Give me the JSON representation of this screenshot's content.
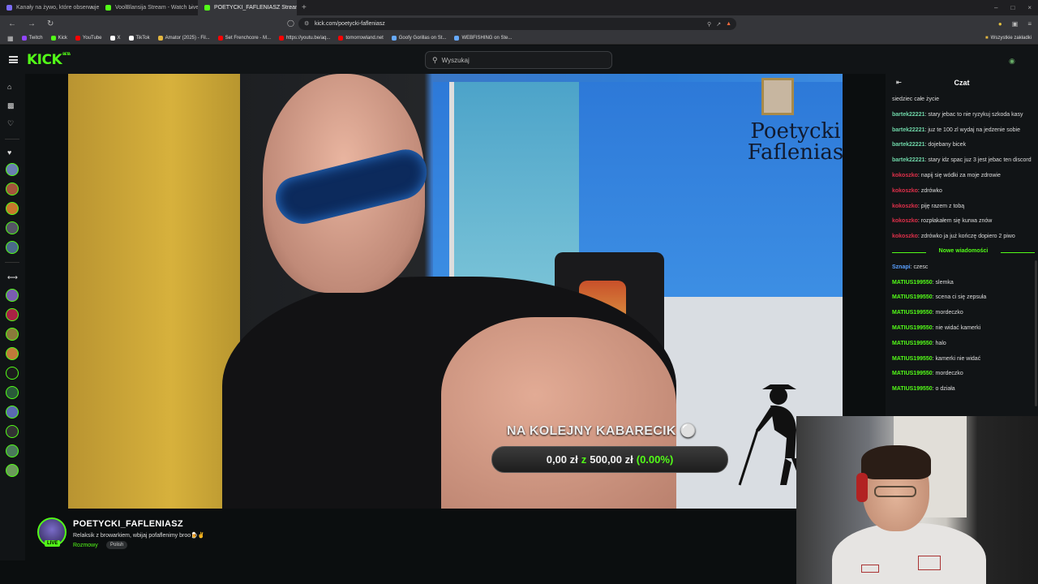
{
  "browser": {
    "tabs": [
      {
        "label": "Kanały na żywo, które obserwujesz",
        "color": "#7b6cf6",
        "active": false
      },
      {
        "label": "VoolBlansija Stream - Watch Live",
        "color": "#53fc18",
        "active": false
      },
      {
        "label": "POETYCKI_FAFLENIASZ Stream",
        "color": "#53fc18",
        "active": true
      }
    ],
    "url": "kick.com/poetycki-fafleniasz",
    "bookmarks": [
      {
        "label": "Twitch",
        "color": "#9146ff"
      },
      {
        "label": "Kick",
        "color": "#53fc18"
      },
      {
        "label": "YouTube",
        "color": "#ff0000"
      },
      {
        "label": "X",
        "color": "#ffffff"
      },
      {
        "label": "TikTok",
        "color": "#ffffff"
      },
      {
        "label": "Amator (2025) - Fil...",
        "color": "#e2b640"
      },
      {
        "label": "Set Frenchcore - M...",
        "color": "#ff0000"
      },
      {
        "label": "https://youtu.be/aq...",
        "color": "#ff0000"
      },
      {
        "label": "tomorrowland.net",
        "color": "#ff0000"
      },
      {
        "label": "Goofy Gorillas on St...",
        "color": "#66aaff"
      },
      {
        "label": "WEBFISHING on Ste...",
        "color": "#66aaff"
      }
    ],
    "bookmarks_all": "Wszystkie zakładki"
  },
  "kick": {
    "logo": "KICK",
    "logo_beta": "BETA",
    "search_placeholder": "Wyszukaj",
    "accent": "#53fc18"
  },
  "stream": {
    "overlay_title": "Poetycki Faflenias",
    "goal_title": "NA KOLEJNY KABARECIK",
    "goal_current": "0,00 zł",
    "goal_sep": "z",
    "goal_target": "500,00 zł",
    "goal_pct": "(0.00%)"
  },
  "channel": {
    "name": "POETYCKI_FAFLENIASZ",
    "title": "Relaksik z browarkiem, wbijaj pofaflenimy broo🍺✌️",
    "category": "Rozmowy",
    "tag": "Polish",
    "live": "LIVE"
  },
  "chat": {
    "header": "Czat",
    "new_messages": "Nowe wiadomości",
    "messages": [
      {
        "user": "",
        "text": "siedziec całe życie",
        "color": "#ddd"
      },
      {
        "user": "bartek22221",
        "text": ": stary jebac to nie ryzykuj szkoda kasy",
        "color": "#6fd6a8"
      },
      {
        "user": "bartek22221",
        "text": ": juz te 100 zl wydaj na jedzenie sobie",
        "color": "#6fd6a8"
      },
      {
        "user": "bartek22221",
        "text": ": dojebany bicek",
        "color": "#6fd6a8"
      },
      {
        "user": "bartek22221",
        "text": ": stary idz spac juz 3 jest jebac ten discord",
        "color": "#6fd6a8"
      },
      {
        "user": "kokoszko",
        "text": ": napij się wódki za moje zdrowie",
        "color": "#e0304a"
      },
      {
        "user": "kokoszko",
        "text": ": zdrówko",
        "color": "#e0304a"
      },
      {
        "user": "kokoszko",
        "text": ": piję razem z tobą",
        "color": "#e0304a"
      },
      {
        "user": "kokoszko",
        "text": ": rozpłakałem się kurwa znów",
        "color": "#e0304a"
      },
      {
        "user": "kokoszko",
        "text": ": zdrówko ja już kończę dopiero 2 piwo",
        "color": "#e0304a"
      }
    ],
    "messages_after": [
      {
        "user": "Sznapi",
        "text": ": czesc",
        "color": "#5aa0ff"
      },
      {
        "user": "MATIUS199550",
        "text": ": slemka",
        "color": "#53fc18"
      },
      {
        "user": "MATIUS199550",
        "text": ": scena ci się zepsuła",
        "color": "#53fc18"
      },
      {
        "user": "MATIUS199550",
        "text": ": mordeczko",
        "color": "#53fc18"
      },
      {
        "user": "MATIUS199550",
        "text": ": nie widać kamerki",
        "color": "#53fc18"
      },
      {
        "user": "MATIUS199550",
        "text": ": halo",
        "color": "#53fc18"
      },
      {
        "user": "MATIUS199550",
        "text": ": kamerki nie widać",
        "color": "#53fc18"
      },
      {
        "user": "MATIUS199550",
        "text": ": mordeczko",
        "color": "#53fc18"
      },
      {
        "user": "MATIUS199550",
        "text": ": o działa",
        "color": "#53fc18"
      }
    ]
  }
}
